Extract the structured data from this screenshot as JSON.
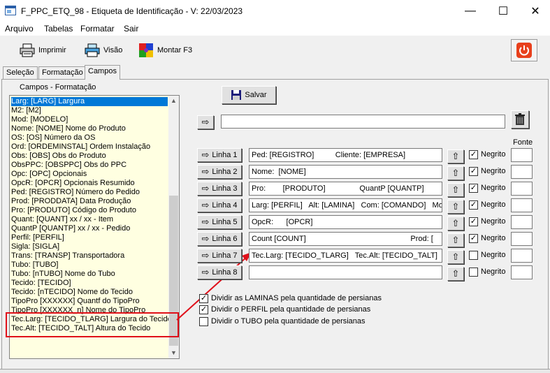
{
  "window": {
    "title": "F_PPC_ETQ_98 - Etiqueta de Identificação - V: 22/03/2023",
    "minimize": "—",
    "maximize": "☐",
    "close": "✕"
  },
  "menu": [
    "Arquivo",
    "Tabelas",
    "Formatar",
    "Sair"
  ],
  "toolbar": {
    "print_label": "Imprimir",
    "view_label": "Visão",
    "build_label": "Montar F3"
  },
  "tabs": [
    "Seleção",
    "Formatação",
    "Campos"
  ],
  "fields_panel": {
    "label": "Campos - Formatação",
    "items": [
      "Larg: [LARG]  Largura",
      "M2: [M2]",
      "Mod: [MODELO]",
      "Nome: [NOME]  Nome do Produto",
      "OS: [OS]  Número da OS",
      "Ord: [ORDEMINSTAL]  Ordem Instalação",
      "Obs: [OBS]  Obs do Produto",
      "ObsPPC: [OBSPPC]  Obs do PPC",
      "Opc: [OPC]  Opcionais",
      "OpcR: [OPCR] Opcionais Resumido",
      "Ped: [REGISTRO]  Número do Pedido",
      "Prod: [PRODDATA]  Data Produção",
      "Pro: [PRODUTO]  Código do Produto",
      "Quant: [QUANT]  xx / xx - Item",
      "QuantP [QUANTP] xx / xx - Pedido",
      "Perfil: [PERFIL]",
      "Sigla: [SIGLA]",
      "Trans: [TRANSP]  Transportadora",
      "Tubo: [TUBO]",
      "Tubo: [nTUBO] Nome do Tubo",
      "Tecido: [TECIDO]",
      "Tecido: [nTECIDO] Nome do Tecido",
      "TipoPro [XXXXXX] Quantf do TipoPro",
      "TipoPro [XXXXXX_n] Nome do TipoPro",
      "Tec.Larg: [TECIDO_TLARG] Largura do Tecido",
      "Tec.Alt: [TECIDO_TALT] Altura do Tecido"
    ]
  },
  "editor": {
    "save_label": "Salvar",
    "font_header": "Fonte",
    "bold_label": "Negrito",
    "top_field": "",
    "lines": [
      {
        "label": "Linha 1",
        "value": "Ped: [REGISTRO]          Cliente: [EMPRESA]",
        "bold": true
      },
      {
        "label": "Linha 2",
        "value": "Nome:  [NOME]",
        "bold": true
      },
      {
        "label": "Linha 3",
        "value": "Pro:        [PRODUTO]                QuantP [QUANTP]",
        "bold": true
      },
      {
        "label": "Linha 4",
        "value": "Larg: [PERFIL]   Alt: [LAMINA]   Com: [COMANDO]   Mod:",
        "bold": true
      },
      {
        "label": "Linha 5",
        "value": "OpcR:      [OPCR]",
        "bold": true
      },
      {
        "label": "Linha 6",
        "value": "Count [COUNT]                                                 Prod: [",
        "bold": true
      },
      {
        "label": "Linha 7",
        "value": "Tec.Larg: [TECIDO_TLARG]   Tec.Alt: [TECIDO_TALT]",
        "bold": false
      },
      {
        "label": "Linha 8",
        "value": "",
        "bold": false
      }
    ],
    "options": [
      {
        "label": "Dividir as LAMINAS pela quantidade de persianas",
        "checked": true
      },
      {
        "label": "Dividir o PERFIL pela quantidade de persianas",
        "checked": true
      },
      {
        "label": "Dividir o TUBO pela quantidade de persianas",
        "checked": false
      }
    ]
  },
  "colors": {
    "list_bg": "#ffffe1",
    "selection": "#0078d7",
    "annotation": "#e0101a"
  }
}
